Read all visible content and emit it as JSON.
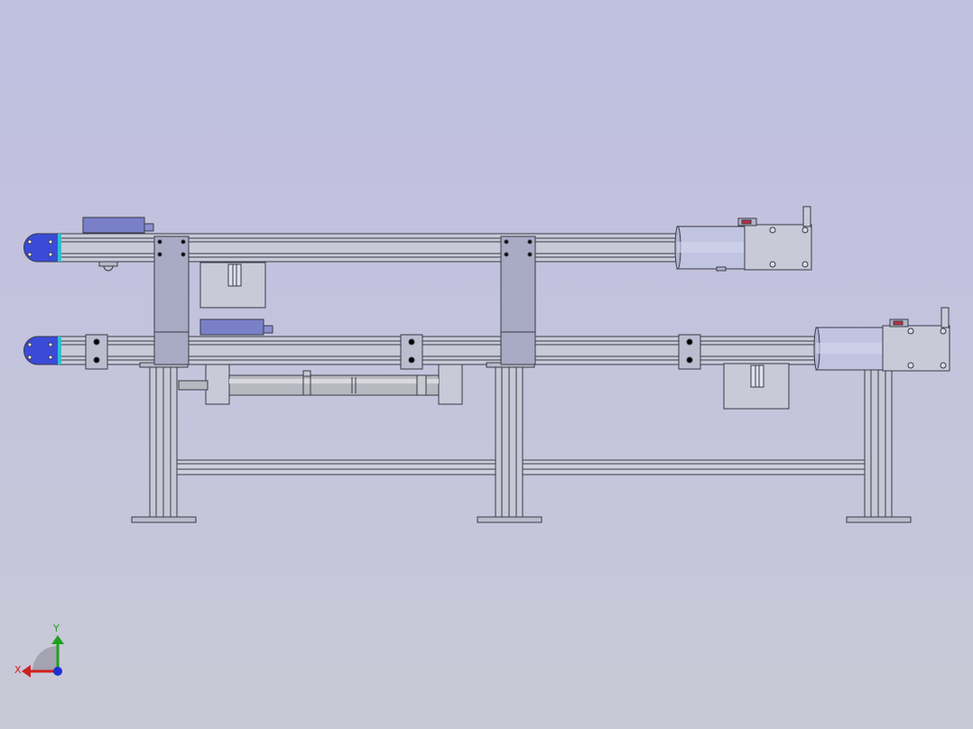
{
  "viewport": {
    "background_top": "#bfbfe0",
    "background_bottom": "#c9c9d6"
  },
  "model": {
    "conveyor_count": 2,
    "conveyors": [
      {
        "name": "upper-conveyor",
        "drive": "motor-gearbox",
        "end_cap": "idler-end-cap"
      },
      {
        "name": "lower-conveyor",
        "drive": "motor-gearbox",
        "end_cap": "idler-end-cap"
      }
    ],
    "components": [
      "aluminum-profile-frame",
      "support-legs",
      "pneumatic-cylinder",
      "sensor-brackets",
      "motor",
      "gearbox"
    ],
    "colors": {
      "profile": "#c8cad8",
      "profile_edge": "#3a3a48",
      "end_cap": "#3a4bd8",
      "motor": "#c0c4e0",
      "bracket": "#a9abc4",
      "cylinder": "#b8b8c0",
      "guide": "#7a80c8"
    }
  },
  "triad": {
    "x_label": "X",
    "y_label": "Y",
    "x_color": "#d02020",
    "y_color": "#20a020",
    "z_color": "#2030d0"
  }
}
